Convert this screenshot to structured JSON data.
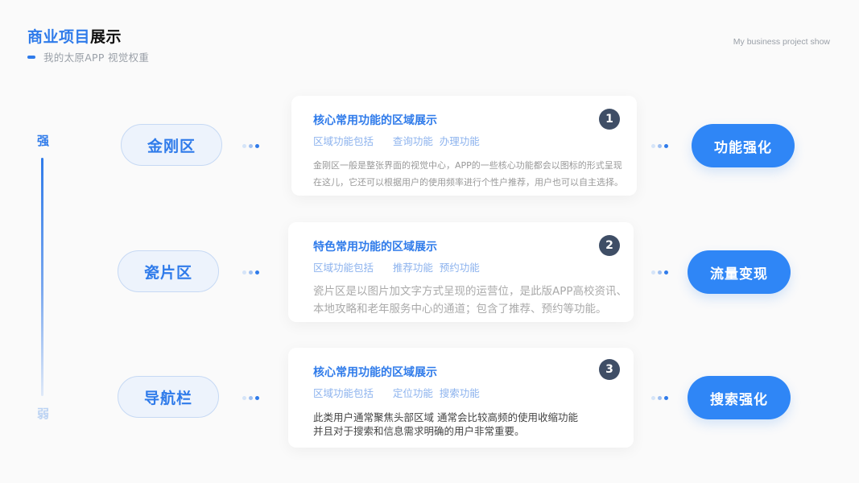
{
  "header": {
    "title_blue": "商业项目",
    "title_dark": "展示",
    "subtitle": "我的太原APP  视觉权重",
    "english": "My business project show"
  },
  "axis": {
    "strong": "强",
    "weak": "弱"
  },
  "rows": [
    {
      "left_label": "金刚区",
      "right_label": "功能强化",
      "number": "1",
      "card_title": "核心常用功能的区域展示",
      "tags": "区域功能包括      查询功能  办理功能",
      "desc_line1": "金刚区一般是整张界面的视觉中心，APP的一些核心功能都会以图标的形式呈现",
      "desc_line2": "在这儿，它还可以根据用户的使用频率进行个性户推荐，用户也可以自主选择。"
    },
    {
      "left_label": "瓷片区",
      "right_label": "流量变现",
      "number": "2",
      "card_title": "特色常用功能的区域展示",
      "tags": "区域功能包括      推荐功能  预约功能",
      "desc_line1": "瓷片区是以图片加文字方式呈现的运营位，是此版APP高校资讯、",
      "desc_line2": "本地攻略和老年服务中心的通道；包含了推荐、预约等功能。"
    },
    {
      "left_label": "导航栏",
      "right_label": "搜索强化",
      "number": "3",
      "card_title": "核心常用功能的区域展示",
      "tags": "区域功能包括      定位功能  搜索功能",
      "desc_line1": "此类用户通常聚焦头部区域  通常会比较高频的使用收缩功能",
      "desc_line2": "并且对于搜索和信息需求明确的用户非常重要。"
    }
  ]
}
